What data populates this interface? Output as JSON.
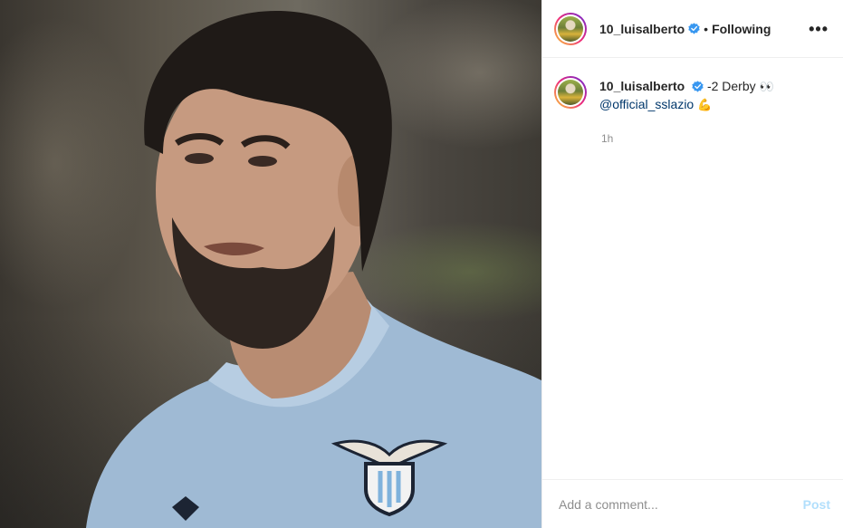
{
  "post": {
    "username": "10_luisalberto",
    "verified": true,
    "follow_status": "Following",
    "separator": "•",
    "more_label": "•••"
  },
  "caption": {
    "text": "-2 Derby",
    "emoji_1": "👀",
    "mention": "@official_sslazio",
    "emoji_2": "💪",
    "time": "1h"
  },
  "comment_box": {
    "placeholder": "Add a comment...",
    "post_label": "Post"
  },
  "colors": {
    "verified_blue": "#3897f0",
    "mention": "#00376b",
    "post_disabled": "#b2dffc",
    "jersey": "#9fbad4"
  },
  "icons": [
    "verified-icon",
    "more-options-icon"
  ]
}
